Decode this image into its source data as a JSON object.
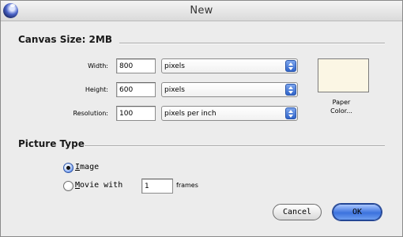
{
  "window": {
    "title": "New"
  },
  "canvas_size": {
    "heading": "Canvas Size: 2MB",
    "width": {
      "label": "Width:",
      "value": "800",
      "unit": "pixels"
    },
    "height": {
      "label": "Height:",
      "value": "600",
      "unit": "pixels"
    },
    "resolution": {
      "label": "Resolution:",
      "value": "100",
      "unit": "pixels per inch"
    },
    "paper_color": {
      "label_line1": "Paper",
      "label_line2": "Color...",
      "color": "#fbf6e4"
    }
  },
  "picture_type": {
    "heading": "Picture Type",
    "options": [
      {
        "accel": "I",
        "rest": "mage",
        "selected": true
      },
      {
        "accel": "M",
        "rest": "ovie with",
        "selected": false
      }
    ],
    "frames_value": "1",
    "frames_label": "frames"
  },
  "buttons": {
    "cancel": "Cancel",
    "ok": "OK"
  }
}
